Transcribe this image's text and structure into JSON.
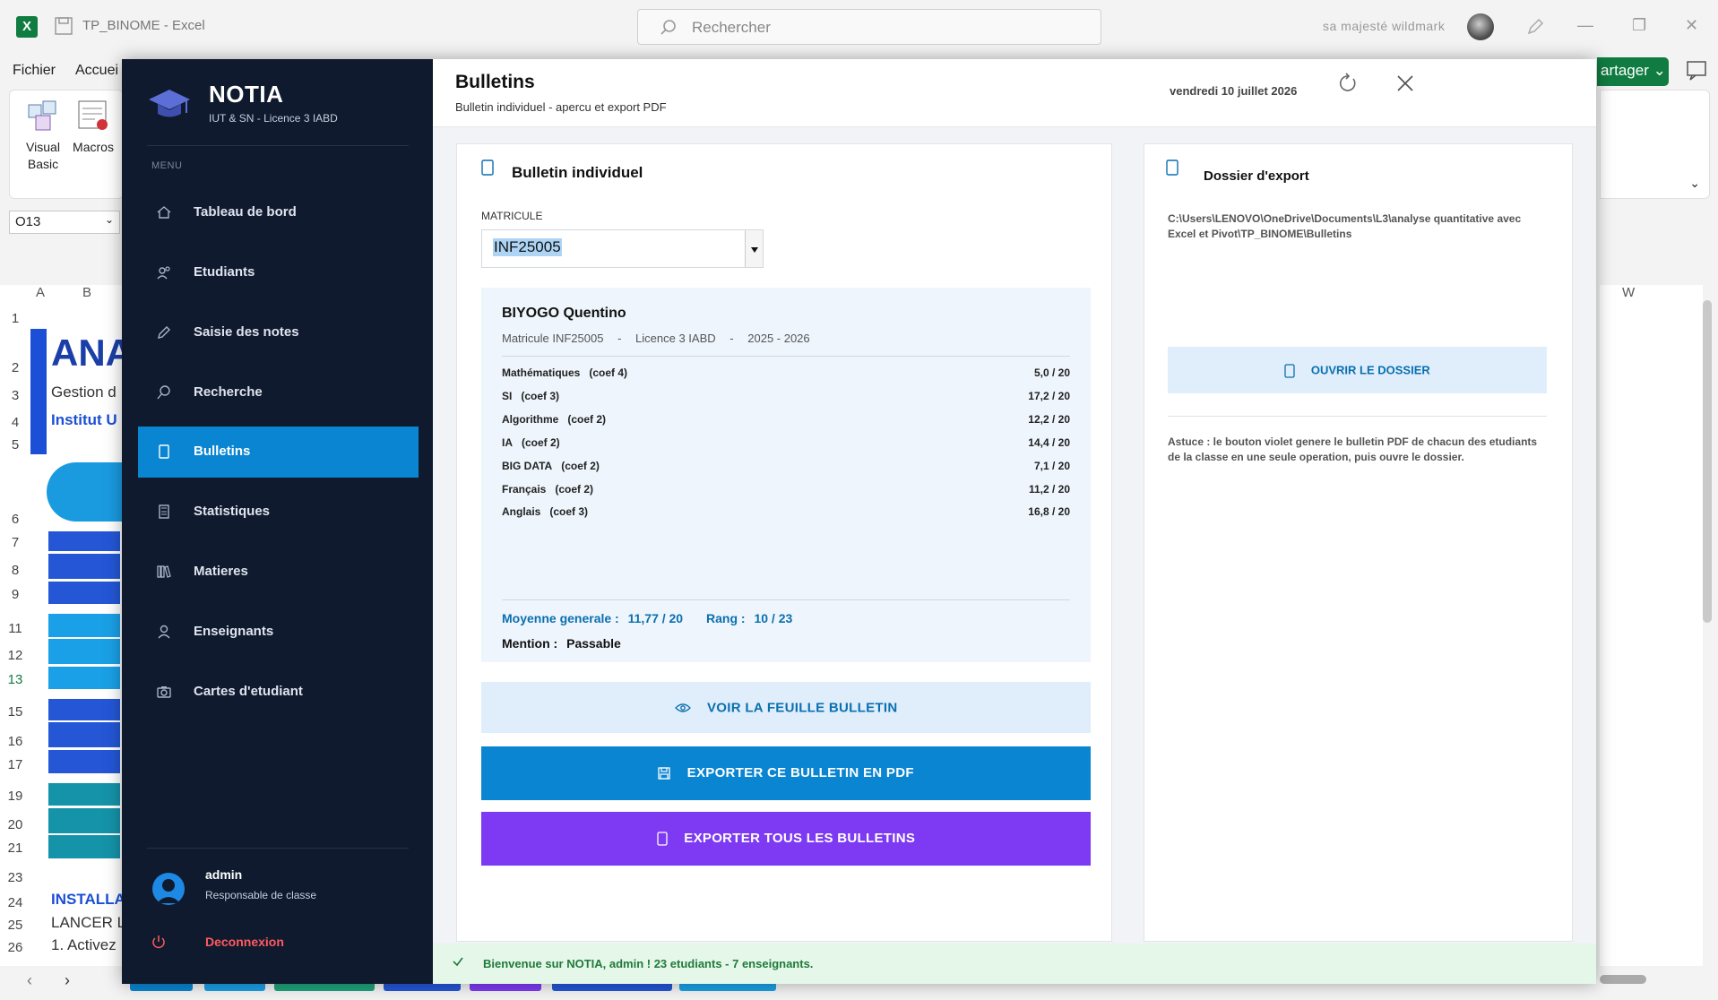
{
  "excel": {
    "logo": "X",
    "title": "TP_BINOME  -  Excel",
    "search_placeholder": "Rechercher",
    "user": "sa majesté wildmark",
    "ribbon_tabs": [
      "Fichier",
      "Accuei"
    ],
    "visual_basic": "Visual Basic",
    "macros": "Macros",
    "namebox": "O13",
    "col_a": "A",
    "col_b": "B",
    "col_w": "W",
    "row_numbers": [
      "1",
      "2",
      "3",
      "4",
      "5",
      "6",
      "7",
      "8",
      "9",
      "11",
      "12",
      "13",
      "15",
      "16",
      "17",
      "19",
      "20",
      "21",
      "23",
      "24",
      "25",
      "26"
    ],
    "cells": {
      "ana": "ANA",
      "gestion": "Gestion d",
      "institut": "Institut U",
      "install": "INSTALLA",
      "lancer": "LANCER L",
      "activez": "1.  Activez"
    },
    "share": "artager"
  },
  "app": {
    "brand": {
      "name": "NOTIA",
      "subtitle": "IUT & SN - Licence 3 IABD"
    },
    "menu_label": "MENU",
    "nav": [
      {
        "label": "Tableau de bord",
        "icon": "home-icon"
      },
      {
        "label": "Etudiants",
        "icon": "users-icon"
      },
      {
        "label": "Saisie des notes",
        "icon": "pencil-icon"
      },
      {
        "label": "Recherche",
        "icon": "search-icon"
      },
      {
        "label": "Bulletins",
        "icon": "document-icon",
        "active": true
      },
      {
        "label": "Statistiques",
        "icon": "calculator-icon"
      },
      {
        "label": "Matieres",
        "icon": "books-icon"
      },
      {
        "label": "Enseignants",
        "icon": "person-icon"
      },
      {
        "label": "Cartes d'etudiant",
        "icon": "camera-icon"
      }
    ],
    "user": {
      "name": "admin",
      "role": "Responsable de classe"
    },
    "logout": "Deconnexion",
    "header": {
      "title": "Bulletins",
      "subtitle": "Bulletin individuel - apercu et export PDF",
      "date": "vendredi 10 juillet 2026"
    },
    "bulletin": {
      "card_title": "Bulletin individuel",
      "matricule_label": "MATRICULE",
      "matricule_value": "INF25005",
      "student_name": "BIYOGO Quentino",
      "meta": [
        "Matricule INF25005",
        "-",
        "Licence 3 IABD",
        "-",
        "2025 - 2026"
      ],
      "grades": [
        {
          "subject": "Mathématiques",
          "coef": "(coef 4)",
          "score": "5,0 / 20"
        },
        {
          "subject": "SI",
          "coef": "(coef 3)",
          "score": "17,2 / 20"
        },
        {
          "subject": "Algorithme",
          "coef": "(coef 2)",
          "score": "12,2 / 20"
        },
        {
          "subject": "IA",
          "coef": "(coef 2)",
          "score": "14,4 / 20"
        },
        {
          "subject": "BIG DATA",
          "coef": "(coef 2)",
          "score": "7,1 / 20"
        },
        {
          "subject": "Français",
          "coef": "(coef 2)",
          "score": "11,2 / 20"
        },
        {
          "subject": "Anglais",
          "coef": "(coef 3)",
          "score": "16,8 / 20"
        }
      ],
      "average_label": "Moyenne generale :",
      "average_value": "11,77 / 20",
      "rank_label": "Rang :",
      "rank_value": "10 / 23",
      "mention_label": "Mention :",
      "mention_value": "Passable",
      "btn_view": "VOIR LA FEUILLE BULLETIN",
      "btn_pdf": "EXPORTER CE BULLETIN EN PDF",
      "btn_all": "EXPORTER TOUS LES BULLETINS"
    },
    "export": {
      "card_title": "Dossier d'export",
      "path": "C:\\Users\\LENOVO\\OneDrive\\Documents\\L3\\analyse quantitative avec Excel et Pivot\\TP_BINOME\\Bulletins",
      "btn_open": "OUVRIR LE DOSSIER",
      "tip": "Astuce :  le bouton violet genere le bulletin PDF de chacun des etudiants de la classe en une seule operation, puis ouvre le dossier."
    },
    "status": "Bienvenue sur NOTIA, admin ! 23 etudiants - 7 enseignants.",
    "colors": {
      "sidebar": "#0f1a2e",
      "accent": "#0a85d1",
      "purple": "#7e3af2",
      "status_bg": "#e4f7e8"
    }
  }
}
